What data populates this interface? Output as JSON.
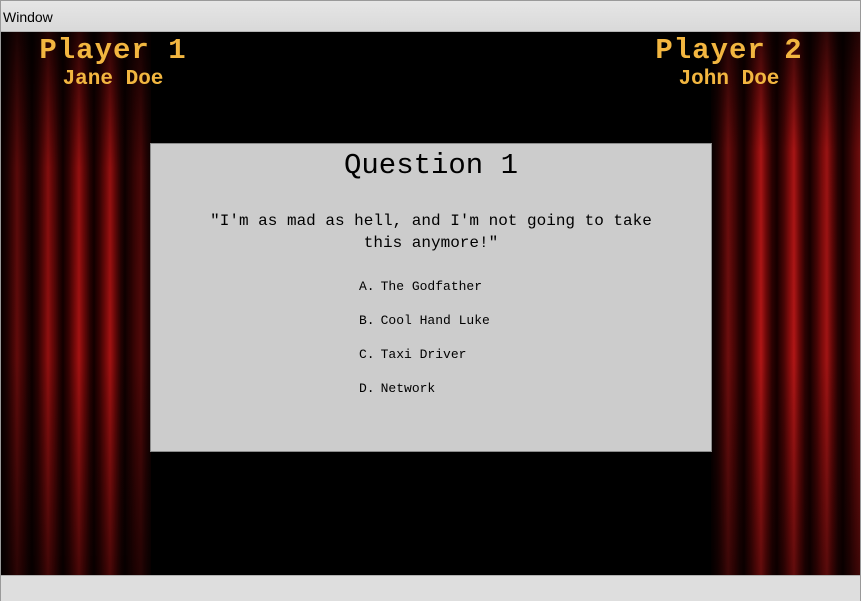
{
  "window": {
    "title": "Window"
  },
  "players": [
    {
      "label": "Player 1",
      "name": "Jane Doe"
    },
    {
      "label": "Player 2",
      "name": "John Doe"
    }
  ],
  "question": {
    "title": "Question 1",
    "quote": "\"I'm as mad as hell, and I'm not going to take this anymore!\"",
    "answers": [
      {
        "letter": "A.",
        "text": "The Godfather"
      },
      {
        "letter": "B.",
        "text": "Cool Hand Luke"
      },
      {
        "letter": "C.",
        "text": "Taxi Driver"
      },
      {
        "letter": "D.",
        "text": "Network"
      }
    ]
  },
  "colors": {
    "player_text": "#f2b640",
    "panel_background": "#cccccc",
    "stage_background": "#000000",
    "curtain": "#a31212"
  }
}
